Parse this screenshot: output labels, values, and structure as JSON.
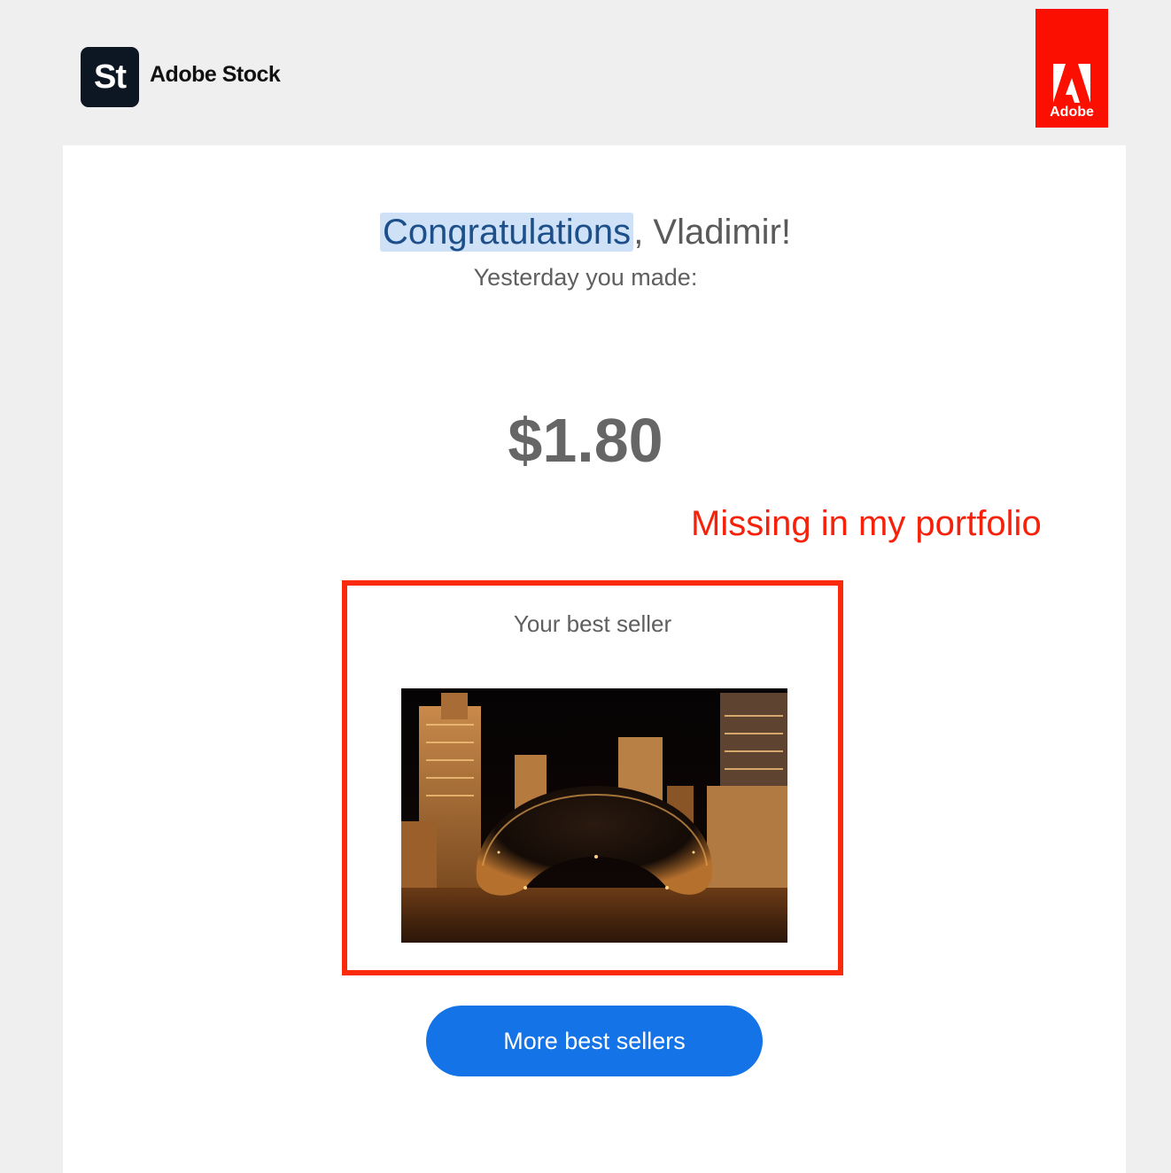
{
  "header": {
    "logo_mark": "St",
    "brand_name": "Adobe Stock",
    "adobe_badge_text": "Adobe"
  },
  "message": {
    "greeting_highlight": "Congratulations",
    "greeting_rest": ", Vladimir!",
    "subtitle": "Yesterday you made:",
    "amount": "$1.80"
  },
  "annotation": {
    "text": "Missing in my portfolio",
    "color": "#f5210a"
  },
  "best_seller": {
    "label": "Your best seller",
    "image_icon": "cloud-gate-night-photo"
  },
  "cta": {
    "label": "More best sellers",
    "color": "#1473e6"
  },
  "colors": {
    "page_background": "#efefef",
    "adobe_red": "#fa0f00",
    "highlight": "#cfe1f7"
  }
}
